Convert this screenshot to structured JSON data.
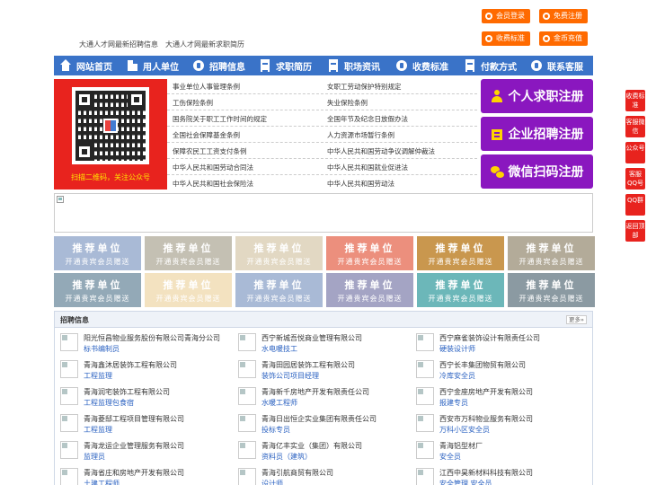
{
  "top_buttons": {
    "member_login": "会员登录",
    "free_register": "免费注册",
    "fee_standard": "收费标准",
    "gold_recharge": "金币充值"
  },
  "slogans": [
    "大通人才网最新招聘信息",
    "大通人才网最新求职简历"
  ],
  "nav": [
    {
      "label": "网站首页",
      "icon": "home-icon"
    },
    {
      "label": "用人单位",
      "icon": "building-icon"
    },
    {
      "label": "招聘信息",
      "icon": "recruit-icon"
    },
    {
      "label": "求职简历",
      "icon": "resume-icon"
    },
    {
      "label": "职场资讯",
      "icon": "news-icon"
    },
    {
      "label": "收费标准",
      "icon": "fee-icon"
    },
    {
      "label": "付款方式",
      "icon": "payment-icon"
    },
    {
      "label": "联系客服",
      "icon": "service-icon"
    }
  ],
  "banner": {
    "caption": "扫描二维码，关注公众号"
  },
  "regulations": {
    "left": [
      "事业单位人事管理条例",
      "工伤保险条例",
      "国务院关于职工工作时间的规定",
      "全国社会保障基金条例",
      "保障农民工工资支付条例",
      "中华人民共和国劳动合同法",
      "中华人民共和国社会保险法"
    ],
    "right": [
      "女职工劳动保护特别规定",
      "失业保险条例",
      "全国年节及纪念日放假办法",
      "人力资源市场暂行条例",
      "中华人民共和国劳动争议调解仲裁法",
      "中华人民共和国就业促进法",
      "中华人民共和国劳动法"
    ]
  },
  "register": {
    "job_seeker": "个人求职注册",
    "company": "企业招聘注册",
    "wechat": "微信扫码注册"
  },
  "recommend": {
    "title": "推荐单位",
    "sub": "开通贵宾会员赠送",
    "colors": [
      "#a9bad6",
      "#c4c0b3",
      "#e2d8c3",
      "#ec8f7d",
      "#c9974e",
      "#b3ab99",
      "#93a9b7",
      "#f3e2c0",
      "#a9bad6",
      "#a4a4c4",
      "#6cb7b9",
      "#8b9aa2"
    ]
  },
  "recruit": {
    "title": "招聘信息",
    "more": "更多»",
    "jobs": [
      {
        "company": "阳光恒昌物业服务股份有限公司青海分公司",
        "position": "标书编制员"
      },
      {
        "company": "西宁新城吾悦商业管理有限公司",
        "position": "水电暖技工"
      },
      {
        "company": "西宁麻雀装饰设计有限责任公司",
        "position": "硬装设计师"
      },
      {
        "company": "青海鑫沐居装饰工程有限公司",
        "position": "工程监理"
      },
      {
        "company": "青海田园居装饰工程有限公司",
        "position": "装饰公司项目经理"
      },
      {
        "company": "西宁长丰集团物贸有限公司",
        "position": "冷库安全员"
      },
      {
        "company": "青海润宅装饰工程有限公司",
        "position": "工程监理包食宿"
      },
      {
        "company": "青海新千房地产开发有限责任公司",
        "position": "水暖工程师"
      },
      {
        "company": "西宁金座房地产开发有限公司",
        "position": "报建专员"
      },
      {
        "company": "青海菱邸工程项目管理有限公司",
        "position": "工程监理"
      },
      {
        "company": "青海日出恒企实业集团有限责任公司",
        "position": "投标专员"
      },
      {
        "company": "西安市万科物业服务有限公司",
        "position": "万科小区安全员"
      },
      {
        "company": "青海龙运企业管理服务有限公司",
        "position": "监理员"
      },
      {
        "company": "青海亿丰实业（集团）有限公司",
        "position": "资料员（建筑）"
      },
      {
        "company": "青海铝型材厂",
        "position": "安全员"
      },
      {
        "company": "青海省庄和房地产开发有限公司",
        "position": "土建工程师"
      },
      {
        "company": "青海引航商贸有限公司",
        "position": "设计师"
      },
      {
        "company": "江西中昊新材料科技有限公司",
        "position": "安全管理 安全员"
      }
    ]
  },
  "side_float": [
    "收费标准",
    "客服微信",
    "公众号",
    "客服QQ号",
    "QQ群",
    "返回顶部"
  ]
}
